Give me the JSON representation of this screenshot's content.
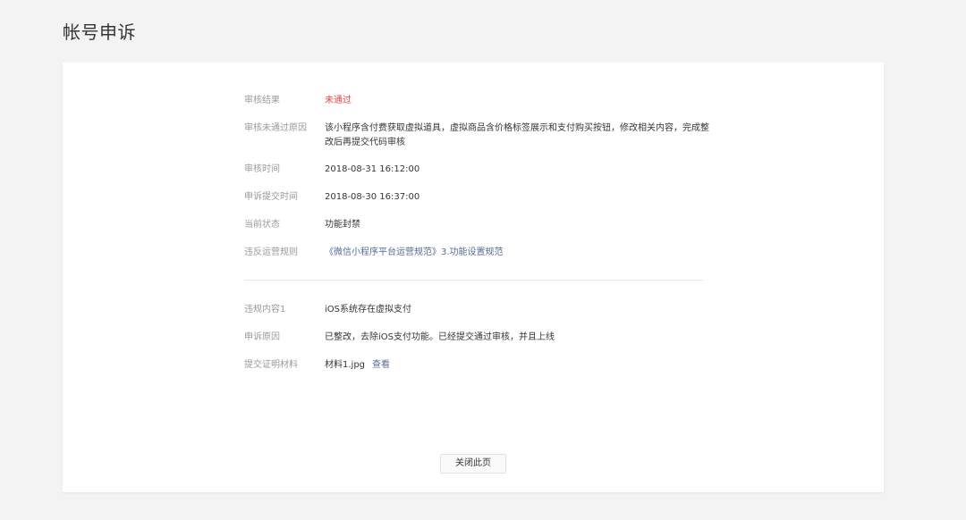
{
  "page": {
    "title": "帐号申诉"
  },
  "review": {
    "result": {
      "label": "审核结果",
      "value": "未通过",
      "color": "#e64340"
    },
    "reason": {
      "label": "审核未通过原因",
      "value": "该小程序含付费获取虚拟道具，虚拟商品含价格标签展示和支付购买按钮，修改相关内容，完成整改后再提交代码审核"
    },
    "review_time": {
      "label": "审核时间",
      "value": "2018-08-31 16:12:00"
    },
    "appeal_time": {
      "label": "申诉提交时间",
      "value": "2018-08-30 16:37:00"
    },
    "status": {
      "label": "当前状态",
      "value": "功能封禁"
    },
    "rule": {
      "label": "违反运营规则",
      "value": "《微信小程序平台运营规范》3.功能设置规范",
      "color": "#576b95"
    }
  },
  "appeal": {
    "content": {
      "label": "违规内容1",
      "value": "iOS系统存在虚拟支付"
    },
    "reason": {
      "label": "申诉原因",
      "value": "已整改，去除iOS支付功能。已经提交通过审核，并且上线"
    },
    "evidence": {
      "label": "提交证明材料",
      "file": "材料1.jpg",
      "view_link": "查看"
    }
  },
  "actions": {
    "close_label": "关闭此页"
  }
}
